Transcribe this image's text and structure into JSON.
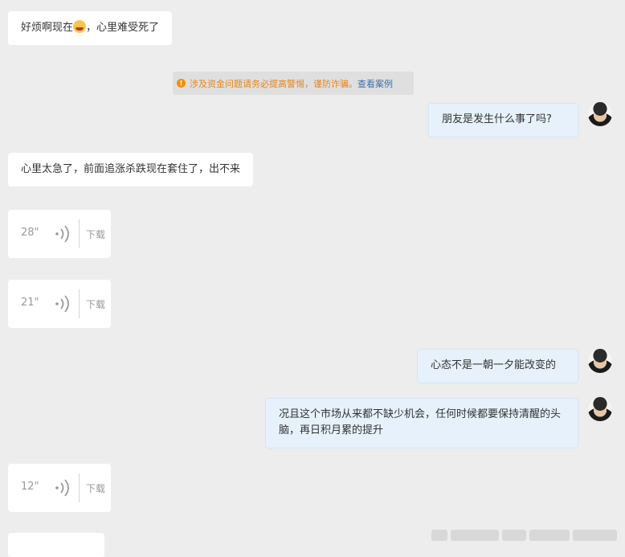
{
  "messages": [
    {
      "side": "in",
      "type": "text",
      "before_emoji": "好烦啊现在",
      "emoji": "crying-face-icon",
      "after_emoji": "，心里难受死了"
    },
    {
      "side": "system",
      "type": "notice",
      "text": "涉及资金问题请务必提高警惕，谨防诈骗。",
      "link": "查看案例"
    },
    {
      "side": "out",
      "type": "text",
      "text": "朋友是发生什么事了吗?"
    },
    {
      "side": "in",
      "type": "text",
      "text": "心里太急了，前面追涨杀跌现在套住了，出不来"
    },
    {
      "side": "in",
      "type": "voice",
      "duration": "28\"",
      "download": "下载"
    },
    {
      "side": "in",
      "type": "voice",
      "duration": "21\"",
      "download": "下载"
    },
    {
      "side": "out",
      "type": "text",
      "text": "心态不是一朝一夕能改变的"
    },
    {
      "side": "out",
      "type": "text",
      "text": "况且这个市场从来都不缺少机会，任何时候都要保持清醒的头脑，再日积月累的提升"
    },
    {
      "side": "in",
      "type": "voice",
      "duration": "12\"",
      "download": "下载"
    }
  ],
  "colors": {
    "background": "#ededed",
    "incoming_bubble": "#ffffff",
    "outgoing_bubble": "#e6f1fb",
    "notice_text": "#e6851a",
    "notice_link": "#3d6fa8"
  }
}
